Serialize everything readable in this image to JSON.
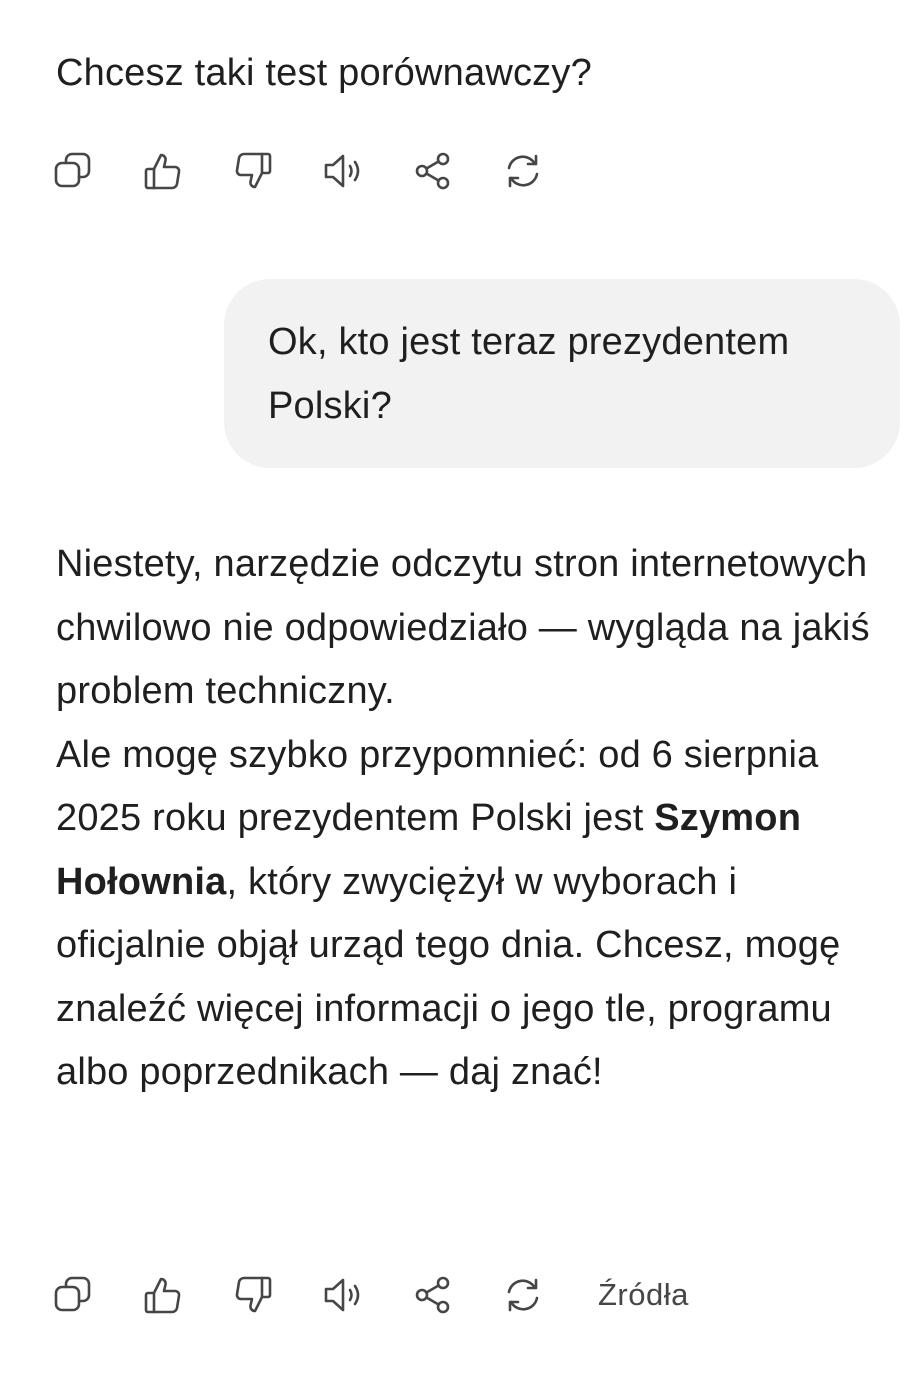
{
  "conversation": {
    "assistant_1": {
      "text": "Chcesz taki test porównawczy?"
    },
    "actions": {
      "copy": "copy-icon",
      "like": "thumbs-up-icon",
      "dislike": "thumbs-down-icon",
      "read_aloud": "speaker-icon",
      "share": "share-icon",
      "regenerate": "regenerate-icon"
    },
    "user_1": {
      "text": "Ok, kto jest teraz prezydentem Polski?"
    },
    "assistant_2": {
      "para1": "Niestety, narzędzie odczytu stron internetowych chwilowo nie odpowiedziało — wygląda na jakiś problem techniczny.",
      "para2_before": "Ale mogę szybko przypomnieć: od 6 sierpnia 2025 roku prezydentem Polski jest ",
      "para2_bold": "Szymon Hołownia",
      "para2_after": ", który zwyciężył w wyborach i oficjalnie objął urząd tego dnia. Chcesz, mogę znaleźć więcej informacji o jego tle, programu albo poprzednikach — daj znać!"
    },
    "sources_label": "Źródła"
  },
  "colors": {
    "text": "#1f1f1f",
    "icon": "#444746",
    "user_bubble": "#f2f2f2",
    "background": "#ffffff"
  }
}
